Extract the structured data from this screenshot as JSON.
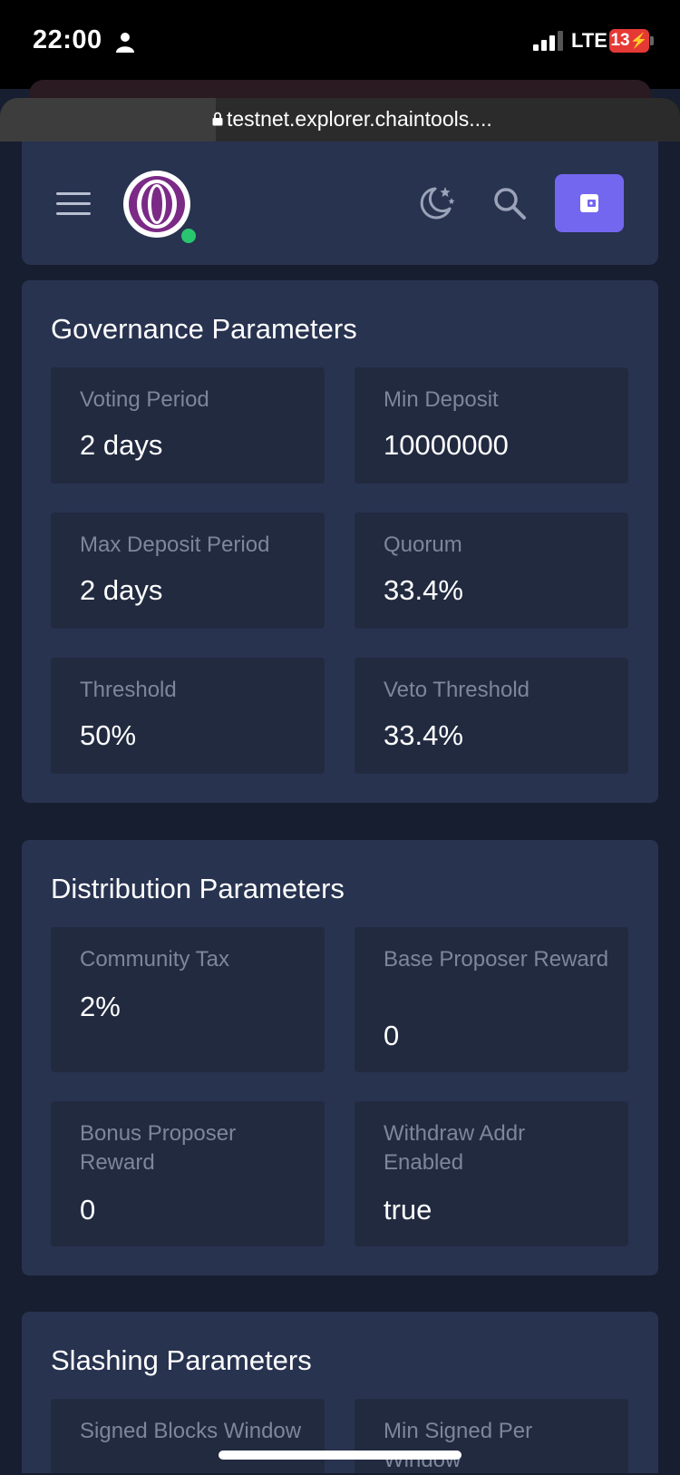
{
  "status_bar": {
    "time": "22:00",
    "network": "LTE",
    "battery": "13"
  },
  "browser": {
    "url": "testnet.explorer.chaintools...."
  },
  "header": {
    "menu_icon": "hamburger-menu-icon",
    "logo_icon": "chain-logo-icon",
    "theme_icon": "moon-stars-icon",
    "search_icon": "search-icon",
    "wallet_icon": "wallet-icon",
    "accent_color": "#7367f0",
    "online_color": "#28c76f"
  },
  "governance": {
    "title": "Governance Parameters",
    "params": [
      {
        "label": "Voting Period",
        "value": "2 days"
      },
      {
        "label": "Min Deposit",
        "value": "10000000"
      },
      {
        "label": "Max Deposit Period",
        "value": "2 days"
      },
      {
        "label": "Quorum",
        "value": "33.4%"
      },
      {
        "label": "Threshold",
        "value": "50%"
      },
      {
        "label": "Veto Threshold",
        "value": "33.4%"
      }
    ]
  },
  "distribution": {
    "title": "Distribution Parameters",
    "params": [
      {
        "label": "Community Tax",
        "value": "2%"
      },
      {
        "label": "Base Proposer Reward",
        "value": "0"
      },
      {
        "label": "Bonus Proposer Reward",
        "value": "0"
      },
      {
        "label": "Withdraw Addr Enabled",
        "value": "true"
      }
    ]
  },
  "slashing": {
    "title": "Slashing Parameters",
    "params": [
      {
        "label": "Signed Blocks Window",
        "value": ""
      },
      {
        "label": "Min Signed Per Window",
        "value": ""
      }
    ]
  }
}
